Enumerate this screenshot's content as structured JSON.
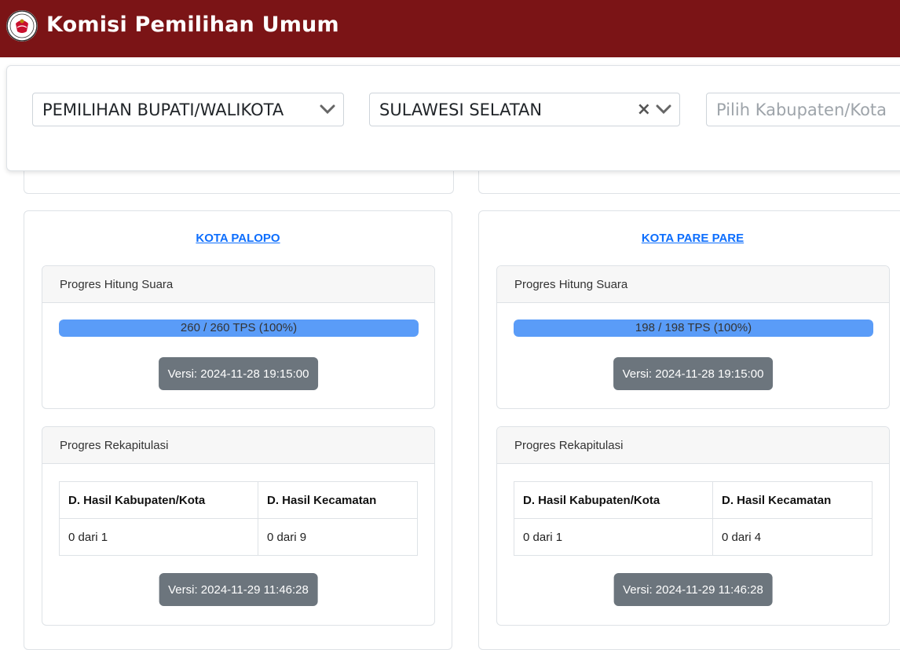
{
  "app": {
    "title": "Komisi Pemilihan Umum"
  },
  "filters": {
    "election_type": "PEMILIHAN BUPATI/WALIKOTA",
    "province": "SULAWESI SELATAN",
    "regency_placeholder": "Pilih Kabupaten/Kota"
  },
  "colors": {
    "header": "#7b1416",
    "link": "#0d6efd",
    "progress": "#5a9cf8",
    "badge": "#6c757d"
  },
  "regions": [
    {
      "name": "KOTA PALOPO",
      "count_progress": {
        "title": "Progres Hitung Suara",
        "label": "260 / 260 TPS (100%)",
        "percent": 100,
        "version": "Versi: 2024-11-28 19:15:00"
      },
      "recap_progress": {
        "title": "Progres Rekapitulasi",
        "columns": [
          "D. Hasil Kabupaten/Kota",
          "D. Hasil Kecamatan"
        ],
        "values": [
          "0 dari 1",
          "0 dari 9"
        ],
        "version": "Versi: 2024-11-29 11:46:28"
      }
    },
    {
      "name": "KOTA PARE PARE",
      "count_progress": {
        "title": "Progres Hitung Suara",
        "label": "198 / 198 TPS (100%)",
        "percent": 100,
        "version": "Versi: 2024-11-28 19:15:00"
      },
      "recap_progress": {
        "title": "Progres Rekapitulasi",
        "columns": [
          "D. Hasil Kabupaten/Kota",
          "D. Hasil Kecamatan"
        ],
        "values": [
          "0 dari 1",
          "0 dari 4"
        ],
        "version": "Versi: 2024-11-29 11:46:28"
      }
    }
  ]
}
